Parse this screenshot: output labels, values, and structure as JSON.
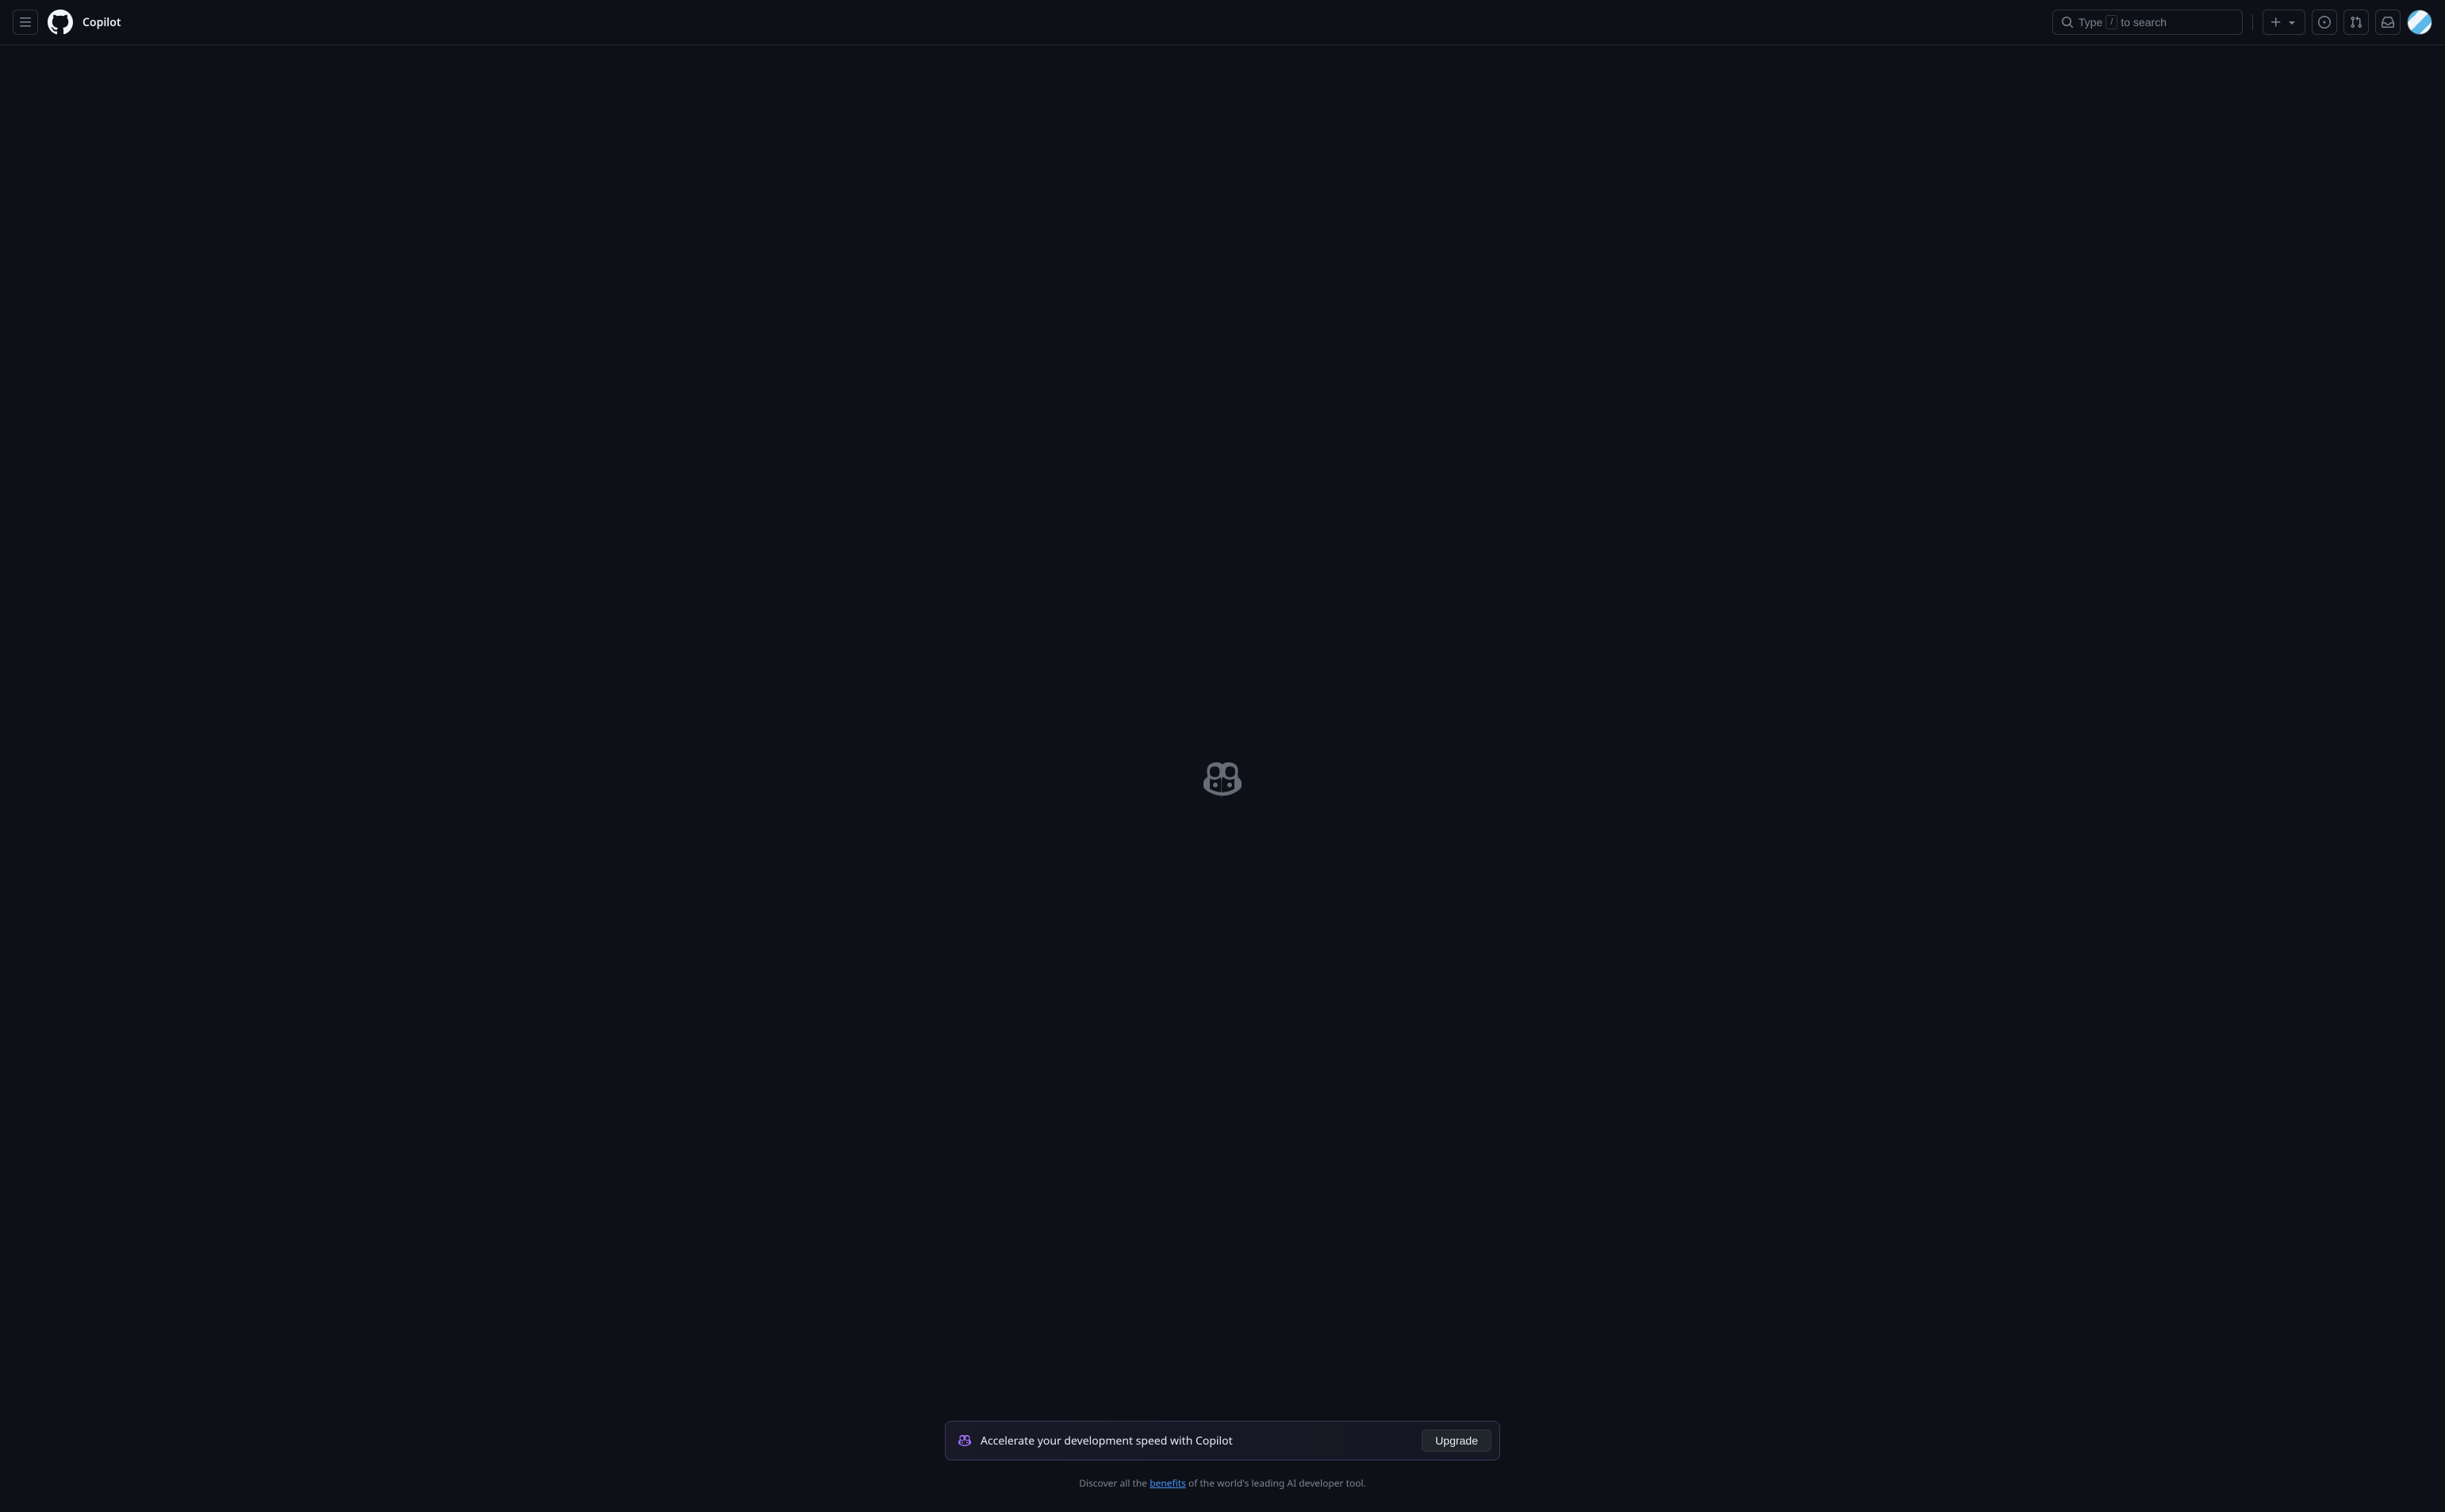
{
  "header": {
    "title": "Copilot",
    "search": {
      "prefix": "Type",
      "key": "/",
      "suffix": "to search"
    }
  },
  "banner": {
    "text": "Accelerate your development speed with Copilot",
    "button_label": "Upgrade"
  },
  "discover": {
    "prefix": "Discover all the ",
    "link_text": "benefits",
    "suffix": " of the world's leading AI developer tool."
  }
}
